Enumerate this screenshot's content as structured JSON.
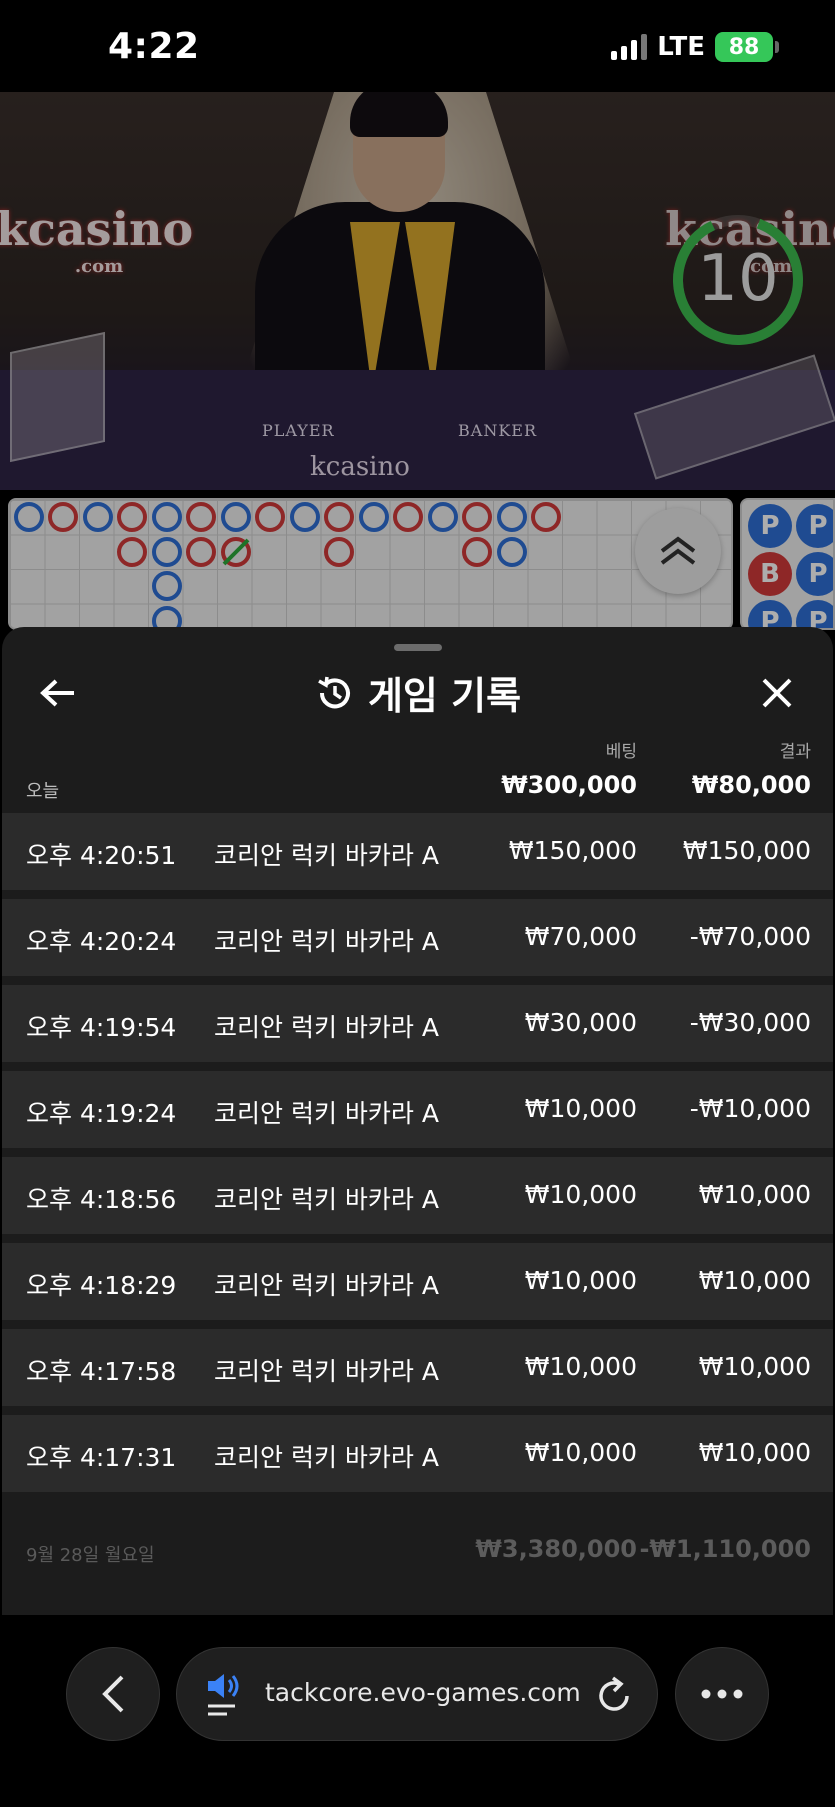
{
  "status_bar": {
    "time": "4:22",
    "network": "LTE",
    "battery": "88"
  },
  "video": {
    "logo_text": "kcasino",
    "logo_sub": ".com",
    "player_label": "PLAYER",
    "banker_label": "BANKER",
    "countdown": "10"
  },
  "bead_labels": [
    "P",
    "B",
    "P"
  ],
  "sheet": {
    "title": "게임 기록",
    "bet_column": "베팅",
    "result_column": "결과",
    "today_label": "오늘",
    "today_bet_total": "₩300,000",
    "today_result_total": "₩80,000",
    "rows": [
      {
        "time": "오후 4:20:51",
        "game": "코리안 럭키 바카라 A",
        "bet": "₩150,000",
        "result": "₩150,000"
      },
      {
        "time": "오후 4:20:24",
        "game": "코리안 럭키 바카라 A",
        "bet": "₩70,000",
        "result": "-₩70,000"
      },
      {
        "time": "오후 4:19:54",
        "game": "코리안 럭키 바카라 A",
        "bet": "₩30,000",
        "result": "-₩30,000"
      },
      {
        "time": "오후 4:19:24",
        "game": "코리안 럭키 바카라 A",
        "bet": "₩10,000",
        "result": "-₩10,000"
      },
      {
        "time": "오후 4:18:56",
        "game": "코리안 럭키 바카라 A",
        "bet": "₩10,000",
        "result": "₩10,000"
      },
      {
        "time": "오후 4:18:29",
        "game": "코리안 럭키 바카라 A",
        "bet": "₩10,000",
        "result": "₩10,000"
      },
      {
        "time": "오후 4:17:58",
        "game": "코리안 럭키 바카라 A",
        "bet": "₩10,000",
        "result": "₩10,000"
      },
      {
        "time": "오후 4:17:31",
        "game": "코리안 럭키 바카라 A",
        "bet": "₩10,000",
        "result": "₩10,000"
      }
    ],
    "previous_day": {
      "date": "9월 28일 월요일",
      "bet_total": "₩3,380,000",
      "result_total": "-₩1,110,000"
    }
  },
  "browser": {
    "url": "tackcore.evo-games.com"
  },
  "colors": {
    "player_blue": "#2f6fd6",
    "banker_red": "#d23a3a",
    "timer_green": "#3dbb4f",
    "sheet_bg": "#1c1c1c",
    "row_bg": "#2b2b2b"
  }
}
